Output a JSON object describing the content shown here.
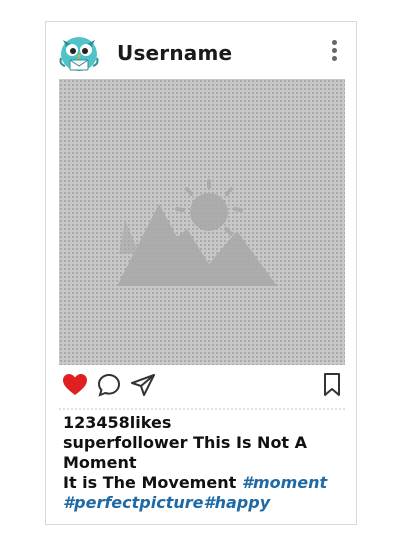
{
  "post": {
    "username": "Username",
    "likes": "123458likes",
    "caption_line1": "superfollower This Is Not A Moment",
    "caption_line2": "It is The Movement",
    "tag_moment": "#moment",
    "tags_line": "#perfectpicture#happy"
  },
  "colors": {
    "like_heart": "#e02020",
    "hashtag": "#1f6aa5",
    "avatar_bird": "#4fc3c8"
  },
  "icons": {
    "avatar": "bird-avatar-icon",
    "more": "kebab-menu-icon",
    "like": "heart-icon",
    "comment": "comment-bubble-icon",
    "share": "paper-plane-icon",
    "save": "bookmark-icon",
    "photo": "image-placeholder-icon"
  }
}
